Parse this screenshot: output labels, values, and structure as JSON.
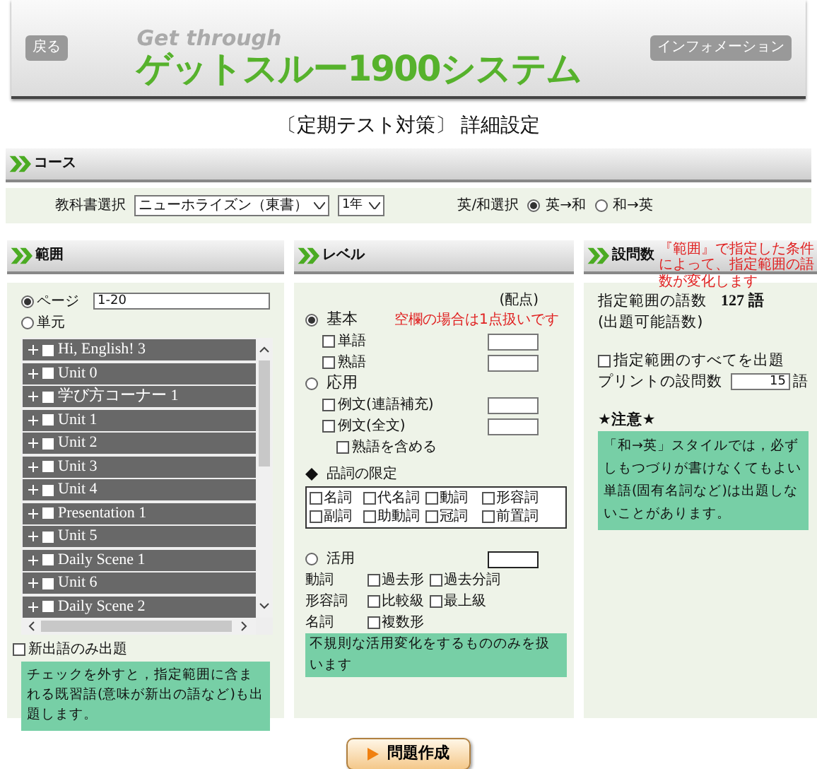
{
  "header": {
    "back_button": "戻る",
    "logo_small": "Get through",
    "logo": "ゲットスルー1900システム",
    "info_button": "インフォメーション"
  },
  "page_title": "〔定期テスト対策〕 詳細設定",
  "course": {
    "heading": "コース",
    "textbook_label": "教科書選択",
    "textbook_select": "ニューホライズン（東書）",
    "grade_select": "1年",
    "direction_label": "英/和選択",
    "directions": [
      {
        "label": "英→和",
        "selected": true
      },
      {
        "label": "和→英",
        "selected": false
      }
    ]
  },
  "range": {
    "heading": "範囲",
    "options": [
      {
        "kind": "page",
        "label": "ページ",
        "value": "1-20",
        "selected": true
      },
      {
        "kind": "unit",
        "label": "単元",
        "selected": false
      }
    ],
    "units": [
      {
        "label": "Hi, English! 3",
        "checked": false
      },
      {
        "label": "Unit 0",
        "checked": false
      },
      {
        "label": "学び方コーナー 1",
        "checked": false
      },
      {
        "label": "Unit 1",
        "checked": false
      },
      {
        "label": "Unit 2",
        "checked": false
      },
      {
        "label": "Unit 3",
        "checked": false
      },
      {
        "label": "Unit 4",
        "checked": false
      },
      {
        "label": "Presentation 1",
        "checked": false
      },
      {
        "label": "Unit 5",
        "checked": false
      },
      {
        "label": "Daily Scene 1",
        "checked": false
      },
      {
        "label": "Unit 6",
        "checked": false
      },
      {
        "label": "Daily Scene 2",
        "checked": false
      }
    ],
    "new_words_only": {
      "label": "新出語のみ出題",
      "checked": false
    },
    "note": "チェックを外すと，指定範囲に含まれる既習語(意味が新出の語など)も出題します。"
  },
  "level": {
    "heading": "レベル",
    "points_label": "(配点)",
    "blank_note": "空欄の場合は1点扱いです",
    "modes": [
      {
        "label": "基本",
        "selected": true,
        "items": [
          {
            "kind": "scored",
            "label": "単語",
            "checked": false
          },
          {
            "kind": "scored",
            "label": "熟語",
            "checked": false
          }
        ]
      },
      {
        "label": "応用",
        "selected": false,
        "items": [
          {
            "kind": "scored",
            "label": "例文(連語補充)",
            "checked": false
          },
          {
            "kind": "scored",
            "label": "例文(全文)",
            "checked": false
          },
          {
            "kind": "option",
            "label": "熟語を含める",
            "checked": false
          }
        ]
      }
    ],
    "pos_label": "品詞の限定",
    "pos": [
      {
        "label": "名詞",
        "checked": false
      },
      {
        "label": "代名詞",
        "checked": false
      },
      {
        "label": "動詞",
        "checked": false
      },
      {
        "label": "形容詞",
        "checked": false
      },
      {
        "label": "副詞",
        "checked": false
      },
      {
        "label": "助動詞",
        "checked": false
      },
      {
        "label": "冠詞",
        "checked": false
      },
      {
        "label": "前置詞",
        "checked": false
      }
    ],
    "conjugation": {
      "label": "活用",
      "selected": false,
      "rows": [
        {
          "label": "動詞",
          "items": [
            {
              "label": "過去形",
              "checked": false
            },
            {
              "label": "過去分詞",
              "checked": false
            }
          ]
        },
        {
          "label": "形容詞",
          "items": [
            {
              "label": "比較級",
              "checked": false
            },
            {
              "label": "最上級",
              "checked": false
            }
          ]
        },
        {
          "label": "名詞",
          "items": [
            {
              "label": "複数形",
              "checked": false
            }
          ]
        }
      ]
    },
    "conjugation_note": "不規則な活用変化をするもののみを扱います"
  },
  "count": {
    "heading": "設問数",
    "header_note": "『範囲』で指定した条件によって、指定範囲の語数が変化します",
    "word_count_label": "指定範囲の語数",
    "word_count": "127 語",
    "available_label": "(出題可能語数)",
    "all": {
      "label": "指定範囲のすべてを出題",
      "checked": false
    },
    "print_label": "プリントの設問数",
    "print_value": "15",
    "print_unit": "語",
    "caution_title": "★注意★",
    "caution": "「和→英」スタイルでは，必ずしもつづりが書けなくてもよい単語(固有名詞など)は出題しないことがあります。"
  },
  "create_button": "問題作成"
}
